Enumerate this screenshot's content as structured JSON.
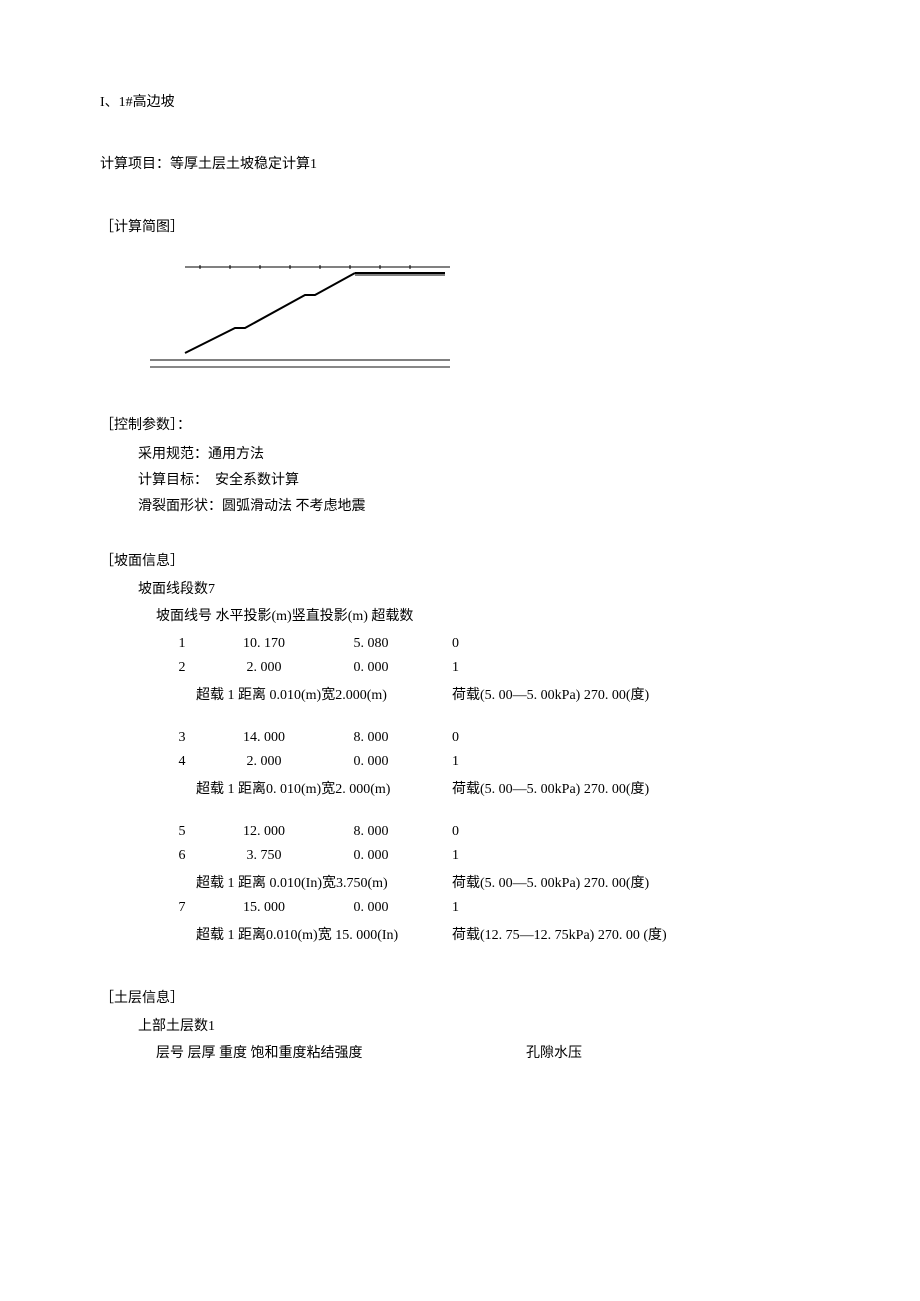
{
  "title": "I、1#高边坡",
  "calc_project": "计算项目：等厚土层土坡稳定计算1",
  "section_diagram": "［计算简图］",
  "section_control": "［控制参数］：",
  "control": {
    "spec": "采用规范：通用方法",
    "target": "计算目标：　安全系数计算",
    "shape": "滑裂面形状：圆弧滑动法 不考虑地震"
  },
  "section_slope": "［坡面信息］",
  "slope_count": "坡面线段数7",
  "slope_header": "坡面线号 水平投影(m)竖直投影(m) 超载数",
  "slope_rows": [
    {
      "no": "1",
      "hp": "10. 170",
      "vp": "5. 080",
      "ov": "0"
    },
    {
      "no": "2",
      "hp": "2. 000",
      "vp": "0. 000",
      "ov": "1",
      "ol_l": "超载 1 距离 0.010(m)宽2.000(m)",
      "ol_r": "荷载(5. 00—5. 00kPa)  270. 00(度)"
    },
    {
      "no": "3",
      "hp": "14. 000",
      "vp": "8. 000",
      "ov": "0"
    },
    {
      "no": "4",
      "hp": "2. 000",
      "vp": "0. 000",
      "ov": "1",
      "ol_l": "超载 1 距离0. 010(m)宽2. 000(m)",
      "ol_r": "荷载(5. 00—5. 00kPa)  270. 00(度)"
    },
    {
      "no": "5",
      "hp": "12. 000",
      "vp": "8. 000",
      "ov": "0"
    },
    {
      "no": "6",
      "hp": "3. 750",
      "vp": "0. 000",
      "ov": "1",
      "ol_l": "超载 1 距离 0.010(In)宽3.750(m)",
      "ol_r": "荷载(5. 00—5. 00kPa)  270. 00(度)"
    },
    {
      "no": "7",
      "hp": "15. 000",
      "vp": "0. 000",
      "ov": "1",
      "ol_l": "超载 1 距离0.010(m)宽 15. 000(In)",
      "ol_r": "荷载(12. 75—12. 75kPa) 270. 00 (度)"
    }
  ],
  "section_soil": "［土层信息］",
  "soil_count": "上部土层数1",
  "soil_header_left": "层号 层厚 重度 饱和重度粘结强度",
  "soil_header_right": "孔隙水压"
}
